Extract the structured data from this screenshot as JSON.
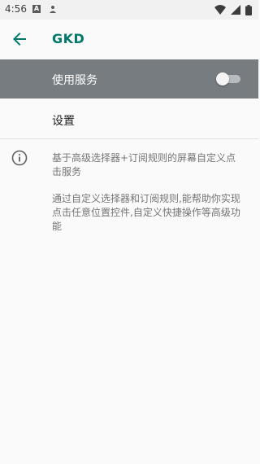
{
  "status_bar": {
    "time": "4:56",
    "left_icons": [
      "a-notification-icon",
      "person-notification-icon"
    ],
    "right_icons": [
      "wifi-icon",
      "cellular-signal-icon",
      "battery-icon"
    ]
  },
  "toolbar": {
    "title": "GKD",
    "back_icon": "arrow-back-icon",
    "accent": "#00796b"
  },
  "service_toggle": {
    "label": "使用服务",
    "state": "off",
    "highlight_color": "#777c80"
  },
  "settings_item": {
    "label": "设置"
  },
  "info": {
    "icon": "info-icon",
    "paragraph1": "基于高级选择器+订阅规则的屏幕自定义点击服务",
    "paragraph2": "通过自定义选择器和订阅规则,能帮助你实现点击任意位置控件,自定义快捷操作等高级功能"
  }
}
